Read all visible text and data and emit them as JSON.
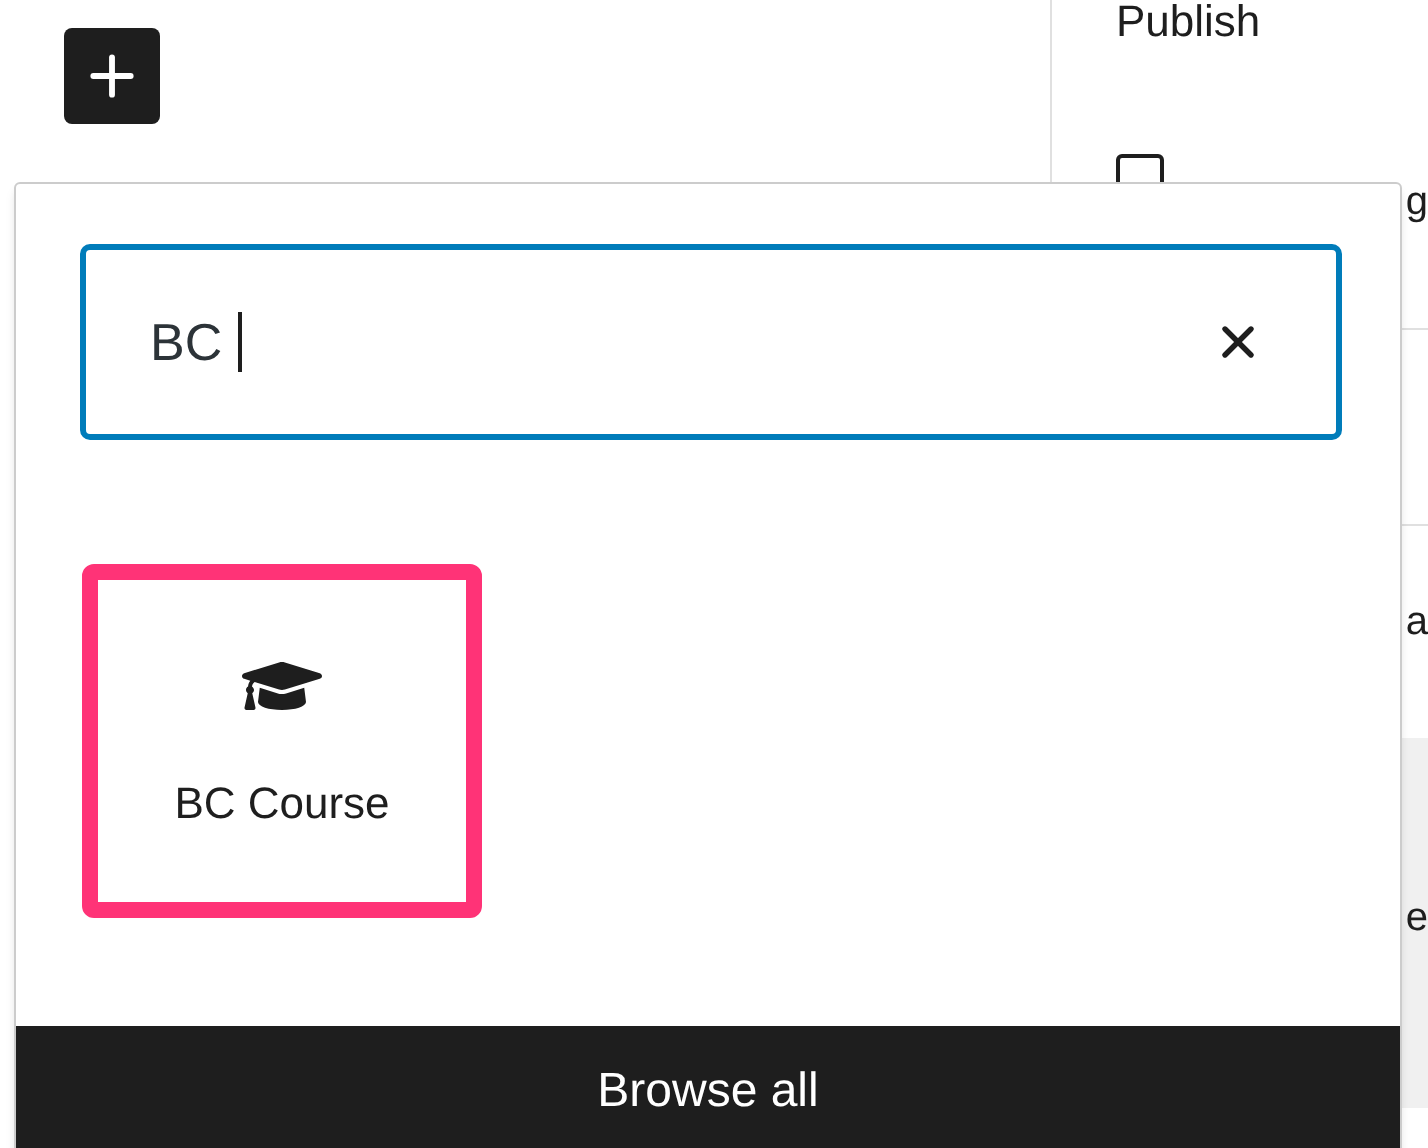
{
  "sidebar": {
    "title": "Publish",
    "checkbox": {
      "checked": false,
      "label": "g"
    },
    "fragments": [
      "a",
      "e"
    ]
  },
  "inserter": {
    "search": {
      "value": "BC"
    },
    "results": [
      {
        "label": "BC Course",
        "selected": true
      }
    ],
    "browse_all": "Browse all"
  }
}
